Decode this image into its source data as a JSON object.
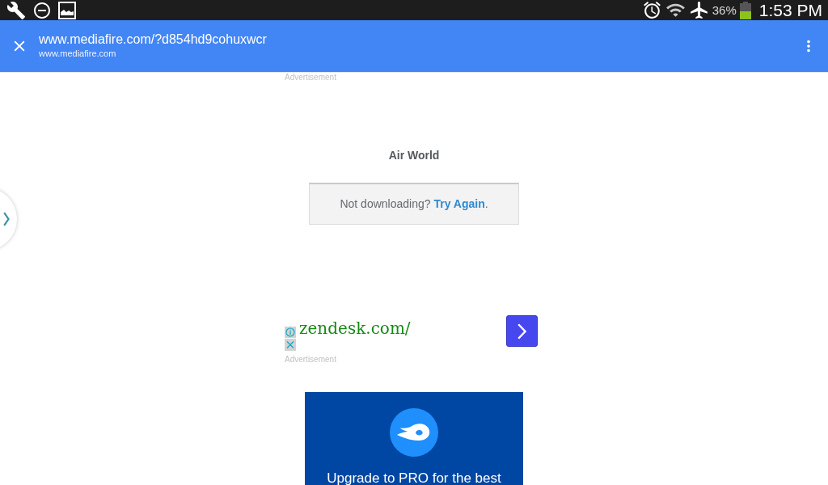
{
  "status_bar": {
    "battery": "36%",
    "time": "1:53 PM"
  },
  "toolbar": {
    "title": "www.mediafire.com/?d854hd9cohuxwcr",
    "subtitle": "www.mediafire.com"
  },
  "page": {
    "top_ad_label": "Advertisement",
    "file_name": "Air World",
    "retry": {
      "text": "Not downloading?",
      "link": "Try Again",
      "suffix": "."
    },
    "ad": {
      "text": "zendesk.com/",
      "label": "Advertisement"
    },
    "promo": {
      "text": "Upgrade to PRO for the best"
    }
  }
}
